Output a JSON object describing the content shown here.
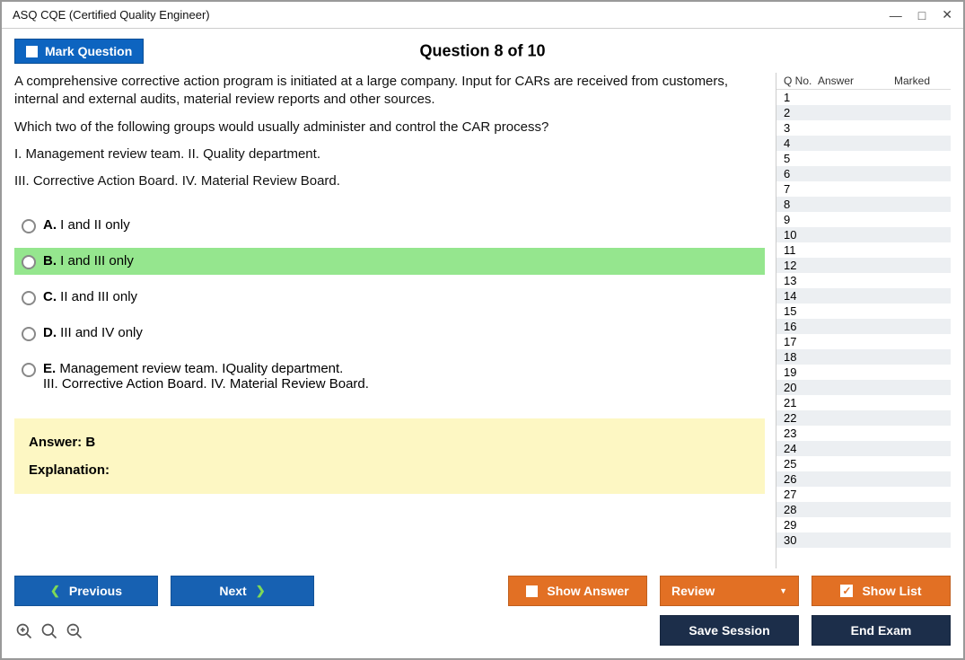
{
  "window": {
    "title": "ASQ CQE (Certified Quality Engineer)"
  },
  "header": {
    "mark_label": "Mark Question",
    "question_title": "Question 8 of 10"
  },
  "question": {
    "prompt1": "A comprehensive corrective action program is initiated at a large company. Input for CARs are received from customers, internal and external audits, material review reports and other sources.",
    "prompt2": "Which two of the following groups would usually administer and control the CAR process?",
    "prompt3": "I. Management review team. II. Quality department.",
    "prompt4": "III. Corrective Action Board. IV. Material Review Board.",
    "options": {
      "a": {
        "letter": "A.",
        "text": " I and II only"
      },
      "b": {
        "letter": "B.",
        "text": " I and III only"
      },
      "c": {
        "letter": "C.",
        "text": " II and III only"
      },
      "d": {
        "letter": "D.",
        "text": " III and IV only"
      },
      "e": {
        "letter": "E.",
        "text": " Management review team. IQuality department.",
        "text2": "III. Corrective Action Board. IV. Material Review Board."
      }
    },
    "answer_line": "Answer: B",
    "explanation_head": "Explanation:"
  },
  "sidebar": {
    "col_qno": "Q No.",
    "col_answer": "Answer",
    "col_marked": "Marked",
    "row_count": 30
  },
  "footer": {
    "previous": "Previous",
    "next": "Next",
    "show_answer": "Show Answer",
    "review": "Review",
    "show_list": "Show List",
    "save_session": "Save Session",
    "end_exam": "End Exam"
  }
}
